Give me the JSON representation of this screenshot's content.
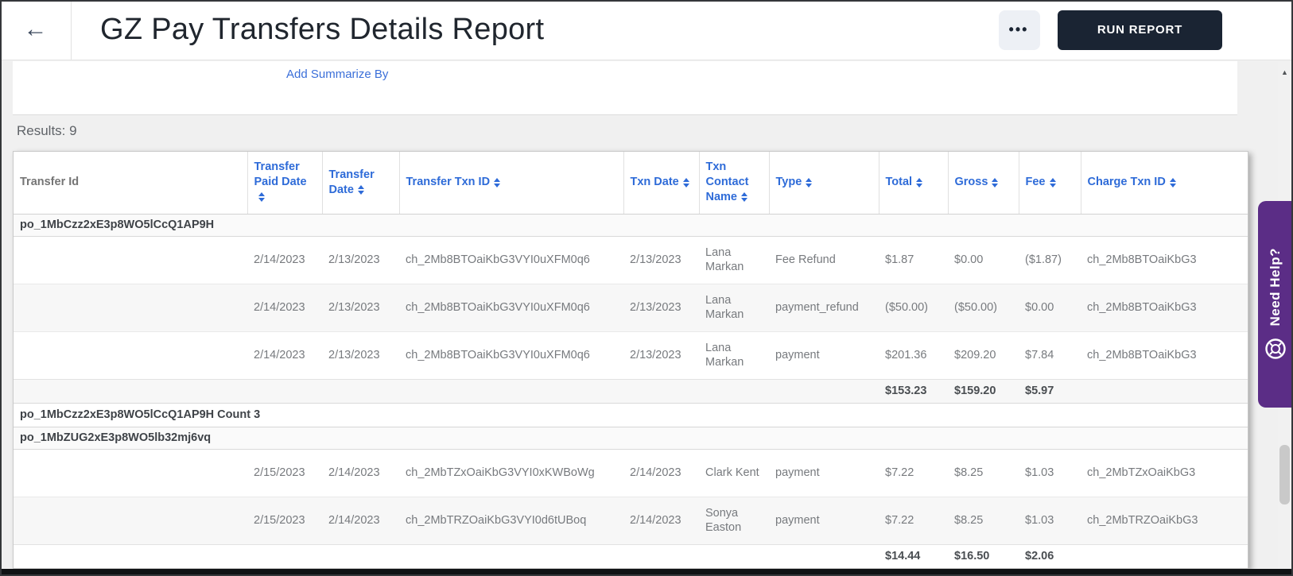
{
  "header": {
    "back_icon": "←",
    "title": "GZ Pay Transfers Details Report",
    "more_icon": "•••",
    "run_report_label": "RUN REPORT"
  },
  "summarize": {
    "add_label": "Add Summarize By"
  },
  "results": {
    "label": "Results: 9"
  },
  "help_tab": {
    "label": "Need Help?"
  },
  "scrollbar": {
    "up_arrow": "▲"
  },
  "colors": {
    "accent_blue": "#2e6bd8",
    "link_blue": "#3b6fd9",
    "run_button_bg": "#1a2433",
    "help_purple": "#5b2d86",
    "shaded_row": "#f7f7f7",
    "page_bg": "#f0f0f0"
  },
  "table": {
    "columns": [
      {
        "key": "transfer_id",
        "label": "Transfer Id",
        "sortable": false
      },
      {
        "key": "transfer_paid_date",
        "label": "Transfer Paid Date",
        "sortable": true
      },
      {
        "key": "transfer_date",
        "label": "Transfer Date",
        "sortable": true
      },
      {
        "key": "transfer_txn_id",
        "label": "Transfer Txn ID",
        "sortable": true
      },
      {
        "key": "txn_date",
        "label": "Txn Date",
        "sortable": true
      },
      {
        "key": "txn_contact_name",
        "label": "Txn Contact Name",
        "sortable": true
      },
      {
        "key": "type",
        "label": "Type",
        "sortable": true
      },
      {
        "key": "total",
        "label": "Total",
        "sortable": true
      },
      {
        "key": "gross",
        "label": "Gross",
        "sortable": true
      },
      {
        "key": "fee",
        "label": "Fee",
        "sortable": true
      },
      {
        "key": "charge_txn_id",
        "label": "Charge Txn ID",
        "sortable": true
      }
    ],
    "groups": [
      {
        "header": "po_1MbCzz2xE3p8WO5lCcQ1AP9H",
        "rows": [
          {
            "transfer_id": "",
            "transfer_paid_date": "2/14/2023",
            "transfer_date": "2/13/2023",
            "transfer_txn_id": "ch_2Mb8BTOaiKbG3VYI0uXFM0q6",
            "txn_date": "2/13/2023",
            "txn_contact_name": "Lana Markan",
            "type": "Fee Refund",
            "total": "$1.87",
            "gross": "$0.00",
            "fee": "($1.87)",
            "charge_txn_id": "ch_2Mb8BTOaiKbG3"
          },
          {
            "transfer_id": "",
            "transfer_paid_date": "2/14/2023",
            "transfer_date": "2/13/2023",
            "transfer_txn_id": "ch_2Mb8BTOaiKbG3VYI0uXFM0q6",
            "txn_date": "2/13/2023",
            "txn_contact_name": "Lana Markan",
            "type": "payment_refund",
            "total": "($50.00)",
            "gross": "($50.00)",
            "fee": "$0.00",
            "charge_txn_id": "ch_2Mb8BTOaiKbG3"
          },
          {
            "transfer_id": "",
            "transfer_paid_date": "2/14/2023",
            "transfer_date": "2/13/2023",
            "transfer_txn_id": "ch_2Mb8BTOaiKbG3VYI0uXFM0q6",
            "txn_date": "2/13/2023",
            "txn_contact_name": "Lana Markan",
            "type": "payment",
            "total": "$201.36",
            "gross": "$209.20",
            "fee": "$7.84",
            "charge_txn_id": "ch_2Mb8BTOaiKbG3"
          }
        ],
        "subtotal": {
          "total": "$153.23",
          "gross": "$159.20",
          "fee": "$5.97"
        },
        "footer": "po_1MbCzz2xE3p8WO5lCcQ1AP9H Count 3"
      },
      {
        "header": "po_1MbZUG2xE3p8WO5lb32mj6vq",
        "rows": [
          {
            "transfer_id": "",
            "transfer_paid_date": "2/15/2023",
            "transfer_date": "2/14/2023",
            "transfer_txn_id": "ch_2MbTZxOaiKbG3VYI0xKWBoWg",
            "txn_date": "2/14/2023",
            "txn_contact_name": "Clark Kent",
            "type": "payment",
            "total": "$7.22",
            "gross": "$8.25",
            "fee": "$1.03",
            "charge_txn_id": "ch_2MbTZxOaiKbG3"
          },
          {
            "transfer_id": "",
            "transfer_paid_date": "2/15/2023",
            "transfer_date": "2/14/2023",
            "transfer_txn_id": "ch_2MbTRZOaiKbG3VYI0d6tUBoq",
            "txn_date": "2/14/2023",
            "txn_contact_name": "Sonya Easton",
            "type": "payment",
            "total": "$7.22",
            "gross": "$8.25",
            "fee": "$1.03",
            "charge_txn_id": "ch_2MbTRZOaiKbG3"
          }
        ],
        "subtotal": {
          "total": "$14.44",
          "gross": "$16.50",
          "fee": "$2.06"
        },
        "footer": null
      }
    ]
  }
}
